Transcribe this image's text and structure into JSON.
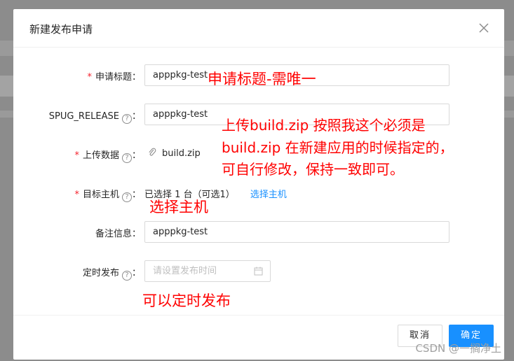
{
  "modal": {
    "title": "新建发布申请",
    "close_icon": "close-icon"
  },
  "form": {
    "title_field": {
      "required_mark": "*",
      "label": "申请标题：",
      "value": "apppkg-test"
    },
    "release_field": {
      "label": "SPUG_RELEASE",
      "help_icon": "?",
      "suffix": "：",
      "value": "apppkg-test"
    },
    "upload_field": {
      "required_mark": "*",
      "label": "上传数据",
      "help_icon": "?",
      "suffix": "：",
      "file_name": "build.zip",
      "file_icon": "paperclip-icon"
    },
    "host_field": {
      "required_mark": "*",
      "label": "目标主机",
      "help_icon": "?",
      "suffix": "：",
      "status": "已选择 1 台（可选1）",
      "select_link": "选择主机"
    },
    "remark_field": {
      "label": "备注信息：",
      "value": "apppkg-test"
    },
    "schedule_field": {
      "label": "定时发布",
      "help_icon": "?",
      "suffix": "：",
      "placeholder": "请设置发布时间",
      "icon": "calendar-icon"
    }
  },
  "footer": {
    "cancel_label": "取消",
    "ok_label": "确定"
  },
  "annotations": {
    "title_note": "申请标题-需唯一",
    "upload_note_line1": "上传build.zip 按照我这个必须是",
    "upload_note_line2": "build.zip 在新建应用的时候指定的，",
    "upload_note_line3": "可自行修改，保持一致即可。",
    "host_note": "选择主机",
    "schedule_note": "可以定时发布"
  },
  "watermark": "CSDN @一搁净土",
  "colors": {
    "primary": "#1890ff",
    "required": "#f5222d",
    "annotation": "#ff0000"
  }
}
